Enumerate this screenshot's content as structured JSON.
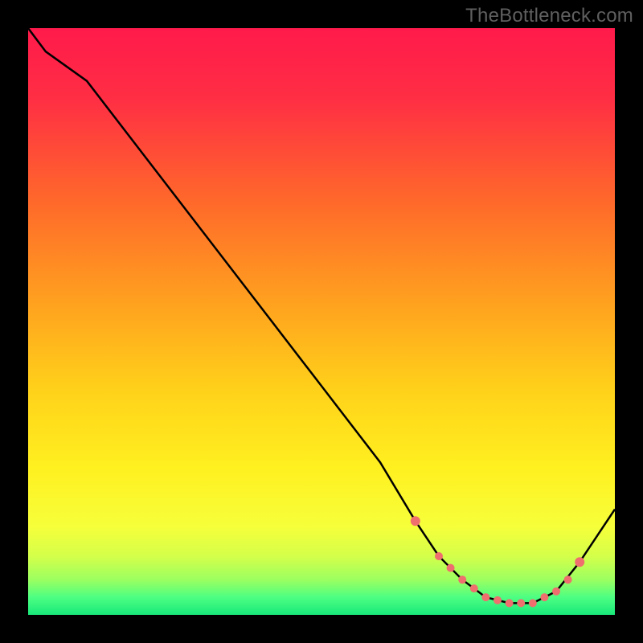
{
  "watermark": "TheBottleneck.com",
  "chart_data": {
    "type": "line",
    "title": "",
    "xlabel": "",
    "ylabel": "",
    "xlim": [
      0,
      100
    ],
    "ylim": [
      0,
      100
    ],
    "series": [
      {
        "name": "curve",
        "x": [
          0,
          3,
          10,
          20,
          30,
          40,
          50,
          60,
          66,
          70,
          74,
          78,
          82,
          86,
          90,
          94,
          100
        ],
        "y": [
          100,
          96,
          91,
          78,
          65,
          52,
          39,
          26,
          16,
          10,
          6,
          3,
          2,
          2,
          4,
          9,
          18
        ]
      }
    ],
    "highlight_points": {
      "name": "sweet-spot",
      "x": [
        66,
        70,
        72,
        74,
        76,
        78,
        80,
        82,
        84,
        86,
        88,
        90,
        92,
        94
      ],
      "y": [
        16,
        10,
        8,
        6,
        4.5,
        3,
        2.5,
        2,
        2,
        2,
        3,
        4,
        6,
        9
      ]
    },
    "gradient_stops": [
      {
        "offset": 0.0,
        "color": "#ff1a4b"
      },
      {
        "offset": 0.12,
        "color": "#ff2e44"
      },
      {
        "offset": 0.3,
        "color": "#ff6a2a"
      },
      {
        "offset": 0.48,
        "color": "#ffa51e"
      },
      {
        "offset": 0.62,
        "color": "#ffd21a"
      },
      {
        "offset": 0.75,
        "color": "#fff020"
      },
      {
        "offset": 0.85,
        "color": "#f6ff3a"
      },
      {
        "offset": 0.9,
        "color": "#d4ff4a"
      },
      {
        "offset": 0.94,
        "color": "#9cff60"
      },
      {
        "offset": 0.97,
        "color": "#4dff82"
      },
      {
        "offset": 1.0,
        "color": "#18e87a"
      }
    ],
    "marker_color": "#ef6e6e",
    "curve_color": "#000000"
  }
}
